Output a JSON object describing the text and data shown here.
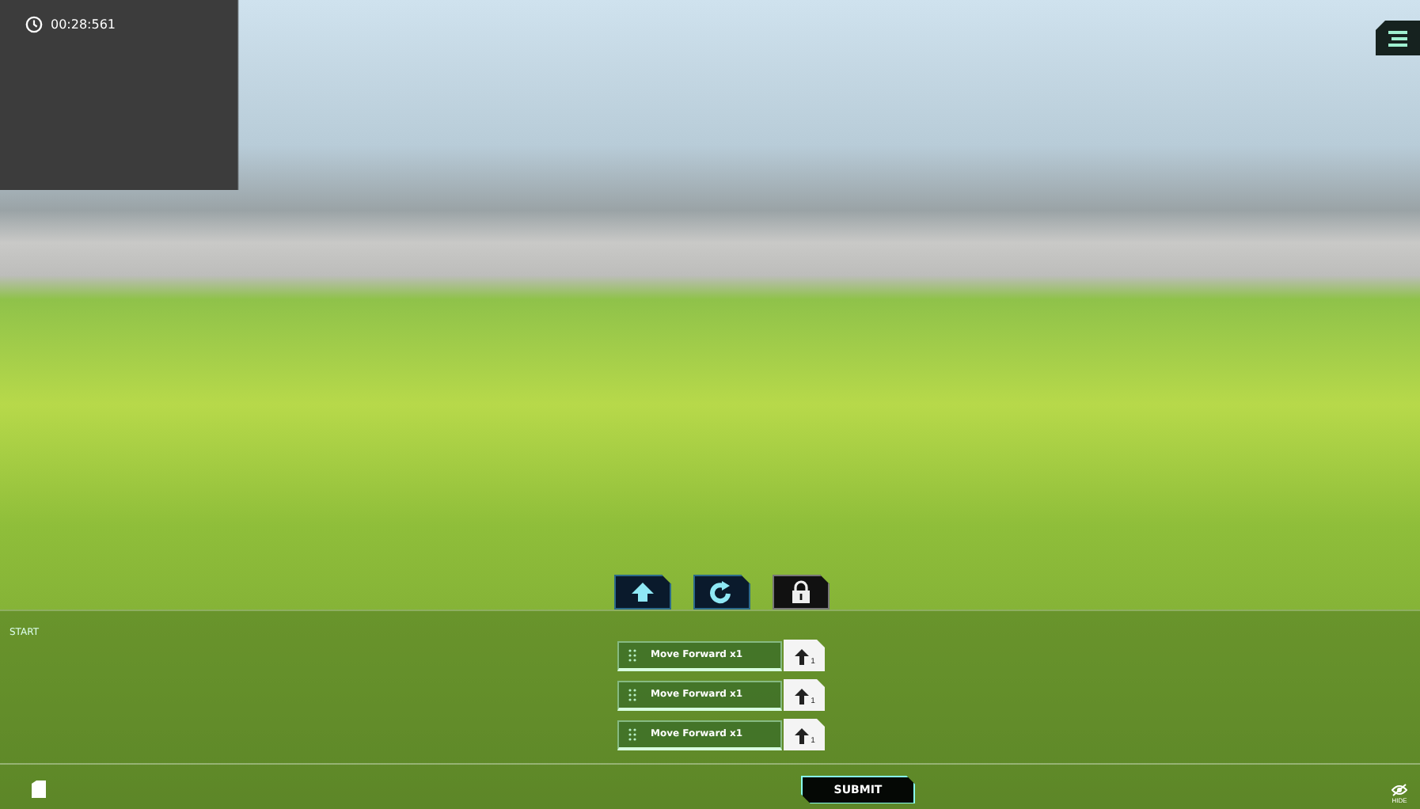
{
  "timer": "00:28:561",
  "tool_buttons": [
    {
      "kind": "forward"
    },
    {
      "kind": "turn"
    },
    {
      "kind": "locked"
    }
  ],
  "program": {
    "label": "START",
    "blocks": [
      {
        "label": "Move Forward x1",
        "count": "1"
      },
      {
        "label": "Move Forward x1",
        "count": "1"
      },
      {
        "label": "Move Forward x1",
        "count": "1"
      }
    ]
  },
  "submit": "SUBMIT",
  "hide": "HIDE"
}
